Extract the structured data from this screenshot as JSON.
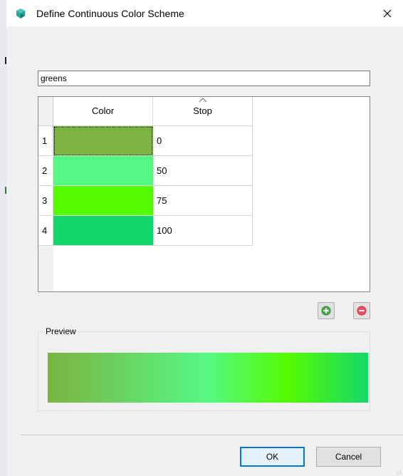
{
  "window": {
    "title": "Define Continuous Color Scheme",
    "icon": "app-icon"
  },
  "scheme_name": {
    "value": "greens",
    "placeholder": ""
  },
  "table": {
    "headers": [
      "Color",
      "Stop"
    ],
    "sorted_column": "Stop",
    "rows": [
      {
        "index": "1",
        "color": "#7cb342",
        "stop": "0"
      },
      {
        "index": "2",
        "color": "#55f884",
        "stop": "50"
      },
      {
        "index": "3",
        "color": "#55fb00",
        "stop": "75"
      },
      {
        "index": "4",
        "color": "#14d76b",
        "stop": "100"
      }
    ]
  },
  "actions": {
    "add_icon": "add-icon",
    "remove_icon": "remove-icon"
  },
  "preview": {
    "label": "Preview"
  },
  "buttons": {
    "ok": "OK",
    "cancel": "Cancel"
  }
}
